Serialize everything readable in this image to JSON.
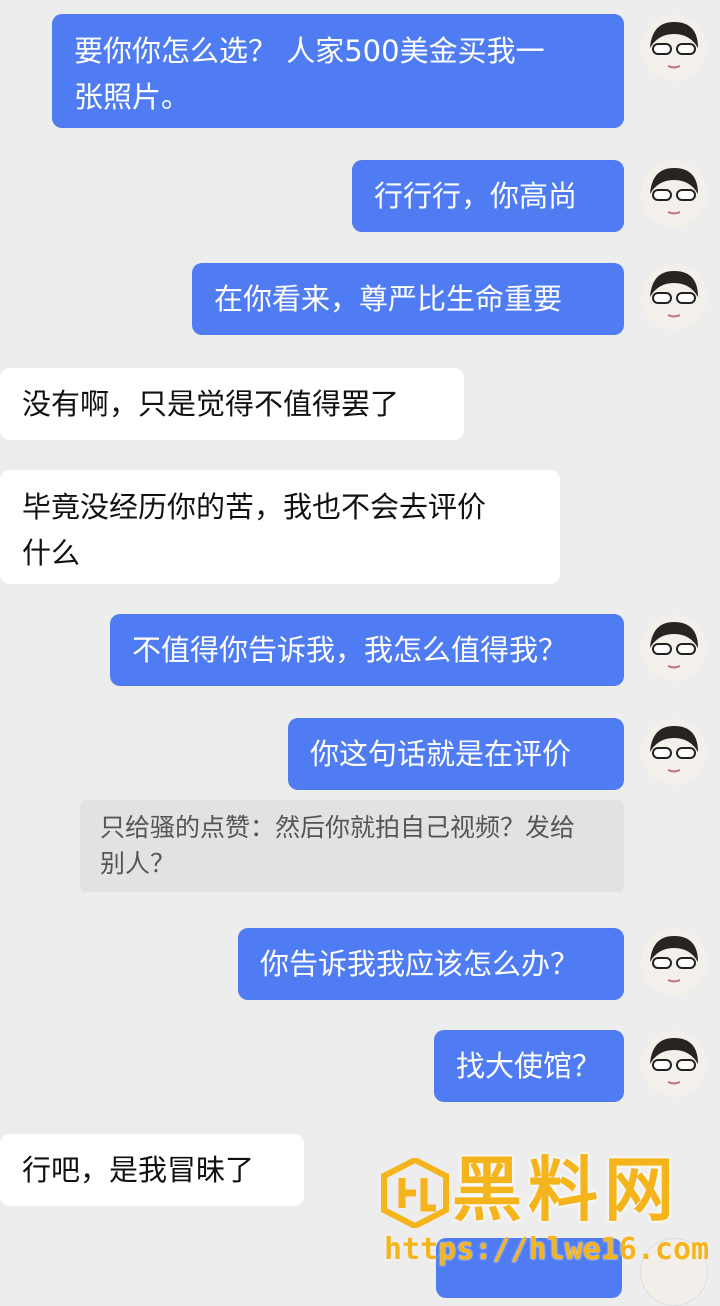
{
  "messages": [
    {
      "id": "m1",
      "side": "sent",
      "text": "要你你怎么选？ 人家500美金买我一\n张照片。"
    },
    {
      "id": "m2",
      "side": "sent",
      "text": "行行行，你高尚"
    },
    {
      "id": "m3",
      "side": "sent",
      "text": "在你看来，尊严比生命重要"
    },
    {
      "id": "m4",
      "side": "recv",
      "text": "没有啊，只是觉得不值得罢了"
    },
    {
      "id": "m5",
      "side": "recv",
      "text": "毕竟没经历你的苦，我也不会去评价\n什么"
    },
    {
      "id": "m6",
      "side": "sent",
      "text": "不值得你告诉我，我怎么值得我？"
    },
    {
      "id": "m7",
      "side": "sent",
      "text": "你这句话就是在评价"
    },
    {
      "id": "m8",
      "side": "sent",
      "text": "你告诉我我应该怎么办？"
    },
    {
      "id": "m9",
      "side": "sent",
      "text": "找大使馆？"
    },
    {
      "id": "m10",
      "side": "recv",
      "text": "行吧，是我冒昧了"
    }
  ],
  "quote": {
    "text": "只给骚的点赞：然后你就拍自己视频？发给\n别人？"
  },
  "watermark": {
    "title": "黑料网",
    "url": "https://hlwe16.com",
    "color": "#f5b31c"
  },
  "colors": {
    "sent_bubble": "#4f7cf3",
    "recv_bubble": "#ffffff",
    "background": "#ededed"
  }
}
